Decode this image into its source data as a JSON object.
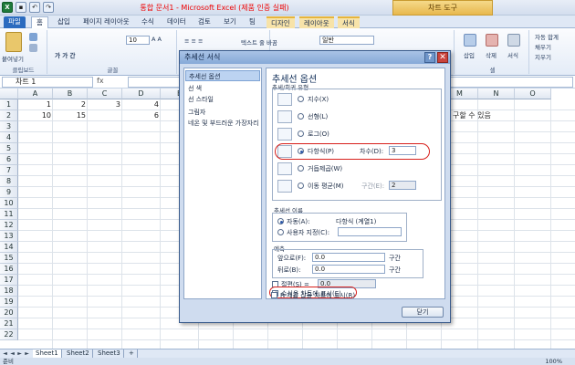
{
  "window": {
    "title": "통합 문서1 - Microsoft Excel (제품 인증 실패)",
    "context_tab": "차트 도구"
  },
  "ribbon": {
    "tabs": [
      "파일",
      "홈",
      "삽입",
      "페이지 레이아웃",
      "수식",
      "데이터",
      "검토",
      "보기",
      "팀",
      "디자인",
      "레이아웃",
      "서식"
    ],
    "clipboard_label": "클립보드",
    "paste_label": "붙여넣기",
    "font_group_label": "글꼴",
    "font_size": "10",
    "wrap_text_label": "텍스트 줄 바꿈",
    "number_format": "일반",
    "insert_label": "삽입",
    "delete_label": "삭제",
    "format_label": "서식",
    "cells_group_label": "셀",
    "autosum_label": "자동 합계",
    "fill_label": "채우기",
    "clear_label": "지우기"
  },
  "formula_bar": {
    "name_box": "차트 1",
    "fx": "fx",
    "content": ""
  },
  "grid": {
    "columns": [
      "A",
      "B",
      "C",
      "D",
      "E",
      "F",
      "G",
      "H",
      "I",
      "J",
      "K",
      "L",
      "M",
      "N",
      "O"
    ],
    "rows": [
      "1",
      "2",
      "3",
      "4",
      "5",
      "6",
      "7",
      "8",
      "9",
      "10",
      "11",
      "12",
      "13",
      "14",
      "15",
      "16",
      "17",
      "18",
      "19",
      "20",
      "21",
      "22"
    ],
    "row1": [
      "1",
      "2",
      "3",
      "4"
    ],
    "row2": [
      "10",
      "15",
      "",
      "6"
    ],
    "partial_text": "구할 수 있음"
  },
  "sheets": [
    "Sheet1",
    "Sheet2",
    "Sheet3"
  ],
  "status": {
    "mode": "준비",
    "zoom": "100%"
  },
  "dialog": {
    "title": "추세선 서식",
    "help": "?",
    "close_x": "✕",
    "nav": [
      "추세선 옵션",
      "선 색",
      "선 스타일",
      "그림자",
      "네온 및 부드러운 가장자리"
    ],
    "heading": "추세선 옵션",
    "type_label": "추세/회귀 유형",
    "types": [
      {
        "label": "지수(X)",
        "checked": false
      },
      {
        "label": "선형(L)",
        "checked": false
      },
      {
        "label": "로그(O)",
        "checked": false
      },
      {
        "label": "다항식(P)",
        "checked": true
      },
      {
        "label": "거듭제곱(W)",
        "checked": false
      },
      {
        "label": "이동 평균(M)",
        "checked": false
      }
    ],
    "order_label": "차수(D):",
    "order_value": "3",
    "period_label": "구간(E):",
    "period_value": "2",
    "name_label": "추세선 이름",
    "name_auto": "자동(A):",
    "name_auto_value": "다항식 (계열1)",
    "name_custom": "사용자 지정(C):",
    "forecast_label": "예측",
    "forward_label": "앞으로(F):",
    "forward_value": "0.0",
    "backward_label": "뒤로(B):",
    "backward_value": "0.0",
    "unit_label": "구간",
    "intercept_label": "절편(S) =",
    "intercept_value": "0.0",
    "show_equation_label": "수식을 차트에 표시(E)",
    "show_r2_label": "R-제곱 값을 차트에 표시(R)",
    "close_button": "닫기"
  },
  "colors": {
    "accent": "#2b6bbf",
    "highlight": "#d8201c",
    "chart_tools": "#e8b84d"
  }
}
